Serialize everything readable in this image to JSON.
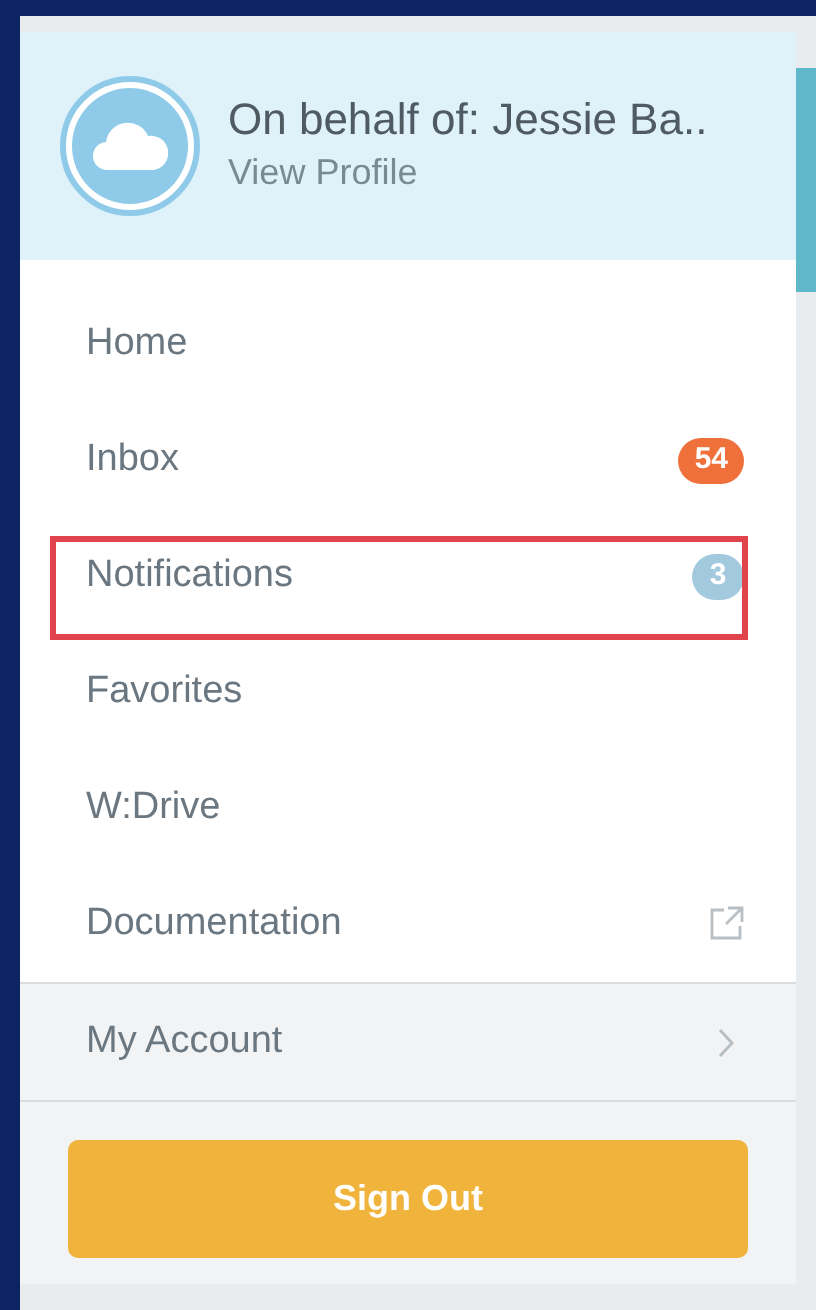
{
  "profile": {
    "name": "On behalf of: Jessie Ba..",
    "link": "View Profile"
  },
  "menu": [
    {
      "kind": "plain",
      "label": "Home",
      "highlighted": false
    },
    {
      "kind": "badge",
      "label": "Inbox",
      "badge": "54",
      "color": "#f0703c",
      "highlighted": false
    },
    {
      "kind": "badge",
      "label": "Notifications",
      "badge": "3",
      "color": "#a3c9df",
      "highlighted": true
    },
    {
      "kind": "plain",
      "label": "Favorites",
      "highlighted": false
    },
    {
      "kind": "plain",
      "label": "W:Drive",
      "highlighted": false
    },
    {
      "kind": "external",
      "label": "Documentation",
      "highlighted": false
    }
  ],
  "account": {
    "label": "My Account"
  },
  "sign_out": "Sign Out"
}
